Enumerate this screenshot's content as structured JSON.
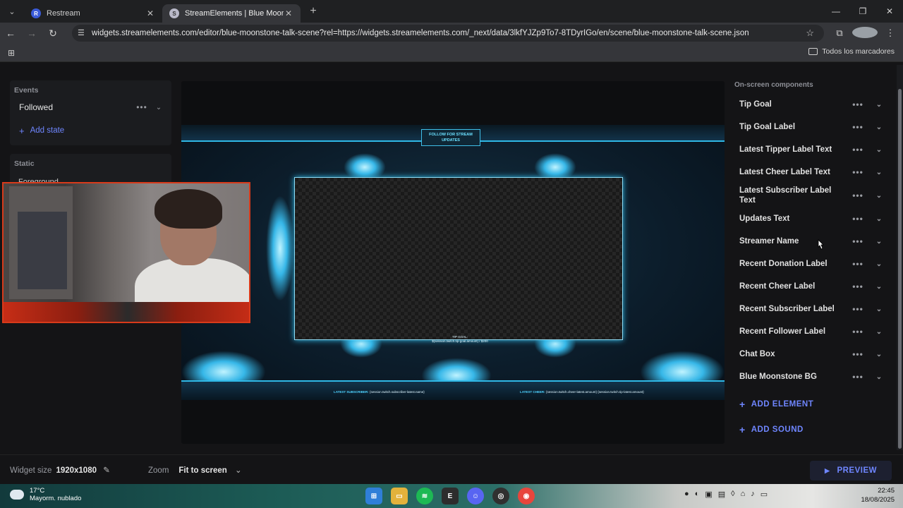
{
  "browser": {
    "tabs": [
      {
        "label": "Restream",
        "favicon": "R",
        "favicon_color": "#3a5bd9",
        "active": false
      },
      {
        "label": "StreamElements | Blue Moonstone",
        "favicon": "SE",
        "favicon_color": "#b9b9c9",
        "active": true
      }
    ],
    "new_tab": "+",
    "url": "widgets.streamelements.com/editor/blue-moonstone-talk-scene?rel=https://widgets.streamelements.com/_next/data/3lkfYJZp9To7-8TDyrIGo/en/scene/blue-moonstone-talk-scene.json",
    "bookmarks_all": "Todos los marcadores"
  },
  "left_panel": {
    "events_heading": "Events",
    "event_selected": "Followed",
    "add_state_label": "Add state",
    "static_heading": "Static",
    "static_item": "Foreground"
  },
  "overlay": {
    "follow_text_1": "FOLLOW FOR STREAM",
    "follow_text_2": "UPDATES",
    "tip_goal_line_1": "TIP GOAL:",
    "tip_goal_line_2": "${session.twitch.tip-goal.amount} / $200",
    "ticker_left_label": "LATEST SUBSCRIBER:",
    "ticker_left_value": "{session.twitch.subscriber-latest.name}",
    "ticker_right_label": "LATEST CHEER:",
    "ticker_right_value": "{session.twitch.cheer-latest.amount} {session.twitch.tip-latest.amount}"
  },
  "right_panel": {
    "heading": "On-screen components",
    "components": [
      "Tip Goal",
      "Tip Goal Label",
      "Latest Tipper Label Text",
      "Latest Cheer Label Text",
      "Latest Subscriber Label Text",
      "Updates Text",
      "Streamer Name",
      "Recent Donation Label",
      "Recent Cheer Label",
      "Recent Subscriber Label",
      "Recent Follower Label",
      "Chat Box",
      "Blue Moonstone BG"
    ],
    "add_element_label": "ADD ELEMENT",
    "add_sound_label": "ADD SOUND"
  },
  "footer": {
    "widget_size_label": "Widget size",
    "widget_size_value": "1920x1080",
    "zoom_label": "Zoom",
    "zoom_value": "Fit to screen",
    "preview_label": "PREVIEW"
  },
  "taskbar": {
    "temperature": "17°C",
    "weather_desc": "Mayorm. nublado",
    "time": "22:45",
    "date": "18/08/2025"
  },
  "colors": {
    "accent": "#6f86ff",
    "overlay_glow": "#2fb8e6",
    "webcam_border": "#d83a1a"
  }
}
